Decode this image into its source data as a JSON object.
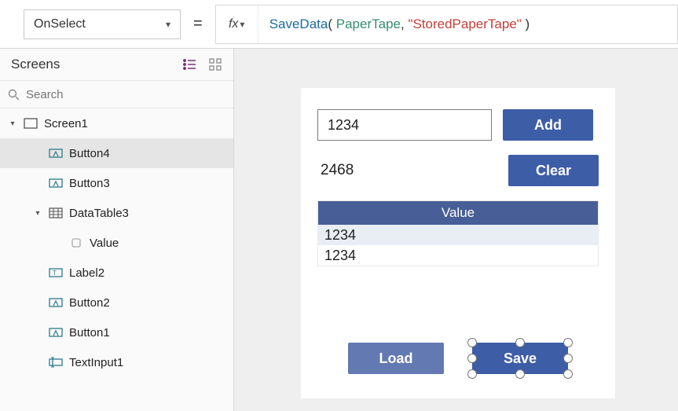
{
  "formula_bar": {
    "property": "OnSelect",
    "fx_label": "fx",
    "formula": {
      "fn": "SaveData",
      "open": "( ",
      "arg1": "PaperTape",
      "sep": ", ",
      "arg2": "\"StoredPaperTape\"",
      "close": " )"
    }
  },
  "tree": {
    "title": "Screens",
    "search_placeholder": "Search",
    "items": [
      {
        "label": "Screen1",
        "kind": "screen",
        "depth": 0,
        "caret": "▾",
        "selected": false
      },
      {
        "label": "Button4",
        "kind": "button",
        "depth": 1,
        "selected": true
      },
      {
        "label": "Button3",
        "kind": "button",
        "depth": 1,
        "selected": false
      },
      {
        "label": "DataTable3",
        "kind": "datatable",
        "depth": 1,
        "caret": "▾",
        "selected": false
      },
      {
        "label": "Value",
        "kind": "column",
        "depth": 2,
        "selected": false
      },
      {
        "label": "Label2",
        "kind": "label",
        "depth": 1,
        "selected": false
      },
      {
        "label": "Button2",
        "kind": "button",
        "depth": 1,
        "selected": false
      },
      {
        "label": "Button1",
        "kind": "button",
        "depth": 1,
        "selected": false
      },
      {
        "label": "TextInput1",
        "kind": "textinput",
        "depth": 1,
        "selected": false
      }
    ]
  },
  "canvas": {
    "textinput_value": "1234",
    "add_label": "Add",
    "label_out": "2468",
    "clear_label": "Clear",
    "datatable": {
      "header": "Value",
      "rows": [
        "1234",
        "1234"
      ]
    },
    "load_label": "Load",
    "save_label": "Save"
  }
}
